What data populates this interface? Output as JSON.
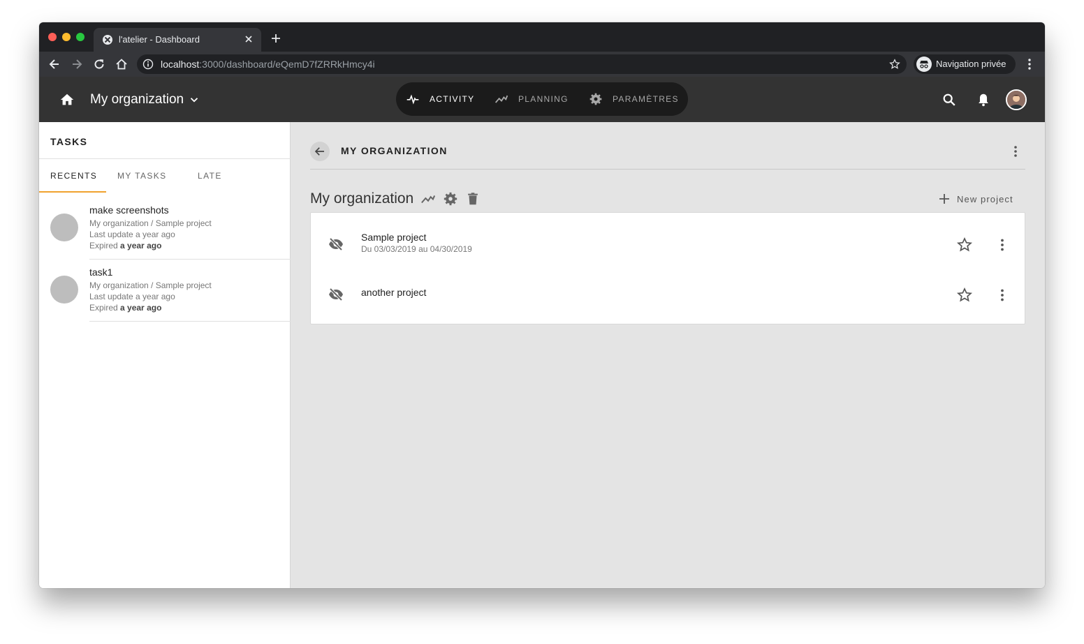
{
  "browser": {
    "tab_title": "l'atelier - Dashboard",
    "url_host": "localhost",
    "url_path": ":3000/dashboard/eQemD7fZRRkHmcy4i",
    "incognito_label": "Navigation privée"
  },
  "header": {
    "org_name": "My organization",
    "nav": [
      {
        "label": "ACTIVITY",
        "icon": "activity-icon",
        "active": true
      },
      {
        "label": "PLANNING",
        "icon": "trending-icon",
        "active": false
      },
      {
        "label": "PARAMÈTRES",
        "icon": "gear-icon",
        "active": false
      }
    ]
  },
  "sidebar": {
    "title": "TASKS",
    "tabs": [
      {
        "label": "RECENTS",
        "active": true
      },
      {
        "label": "MY TASKS",
        "active": false
      },
      {
        "label": "LATE",
        "active": false
      }
    ],
    "tasks": [
      {
        "name": "make screenshots",
        "path": "My organization / Sample project",
        "last_update": "Last update a year ago",
        "expired_prefix": "Expired",
        "expired_value": "a year ago"
      },
      {
        "name": "task1",
        "path": "My organization / Sample project",
        "last_update": "Last update a year ago",
        "expired_prefix": "Expired",
        "expired_value": "a year ago"
      }
    ]
  },
  "main": {
    "title": "MY ORGANIZATION",
    "org_heading": "My organization",
    "new_project_label": "New project",
    "projects": [
      {
        "name": "Sample project",
        "dates": "Du 03/03/2019 au 04/30/2019"
      },
      {
        "name": "another project",
        "dates": ""
      }
    ]
  },
  "colors": {
    "accent": "#f0a22e",
    "appbar": "#333333",
    "nav_pill": "#1b1b1b",
    "main_bg": "#e4e4e4"
  }
}
